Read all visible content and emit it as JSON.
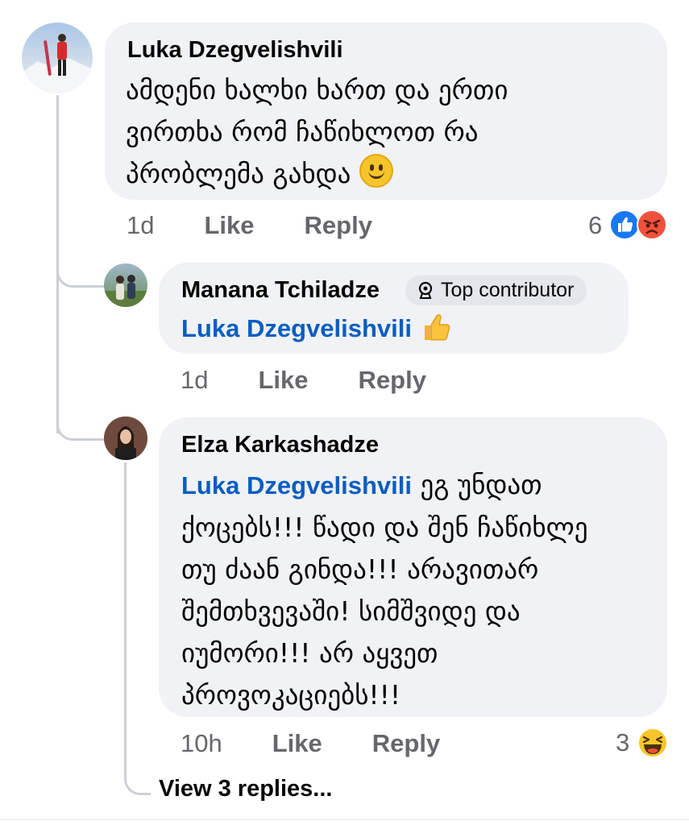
{
  "comments": [
    {
      "author": "Luka Dzegvelishvili",
      "text_lines": [
        "ამდენი ხალხი  ხართ და ერთი",
        "ვირთხა რომ ჩაწიხლოთ რა",
        "პრობლემა გახდა"
      ],
      "time": "1d",
      "like_label": "Like",
      "reply_label": "Reply",
      "reaction_count": "6",
      "reactions": [
        "like-reaction-icon",
        "angry-reaction-icon"
      ],
      "emoji": "slightly-smiling-face-icon"
    },
    {
      "author": "Manana Tchiladze",
      "badge": "Top contributor",
      "mention": "Luka Dzegvelishvili",
      "emoji": "thumbs-up-emoji-icon",
      "time": "1d",
      "like_label": "Like",
      "reply_label": "Reply"
    },
    {
      "author": "Elza Karkashadze",
      "mention": "Luka Dzegvelishvili",
      "first_line_rest": "ეგ უნდათ",
      "text_lines": [
        "ქოცებს!!! წადი და შენ ჩაწიხლე",
        "თუ ძაან გინდა!!! არავითარ",
        "შემთხვევაში! სიმშვიდე და",
        "იუმორი!!! არ აყვეთ",
        "პროვოკაციებს!!!"
      ],
      "time": "10h",
      "like_label": "Like",
      "reply_label": "Reply",
      "reaction_count": "3",
      "reactions": [
        "haha-reaction-icon"
      ]
    }
  ],
  "view_replies": "View 3 replies...",
  "colors": {
    "bubble": "#f0f2f5",
    "mention": "#0a5dc2",
    "meta": "#65676b",
    "like_blue": "#1877f2",
    "angry": "#f0513c",
    "haha": "#f7c52b"
  }
}
